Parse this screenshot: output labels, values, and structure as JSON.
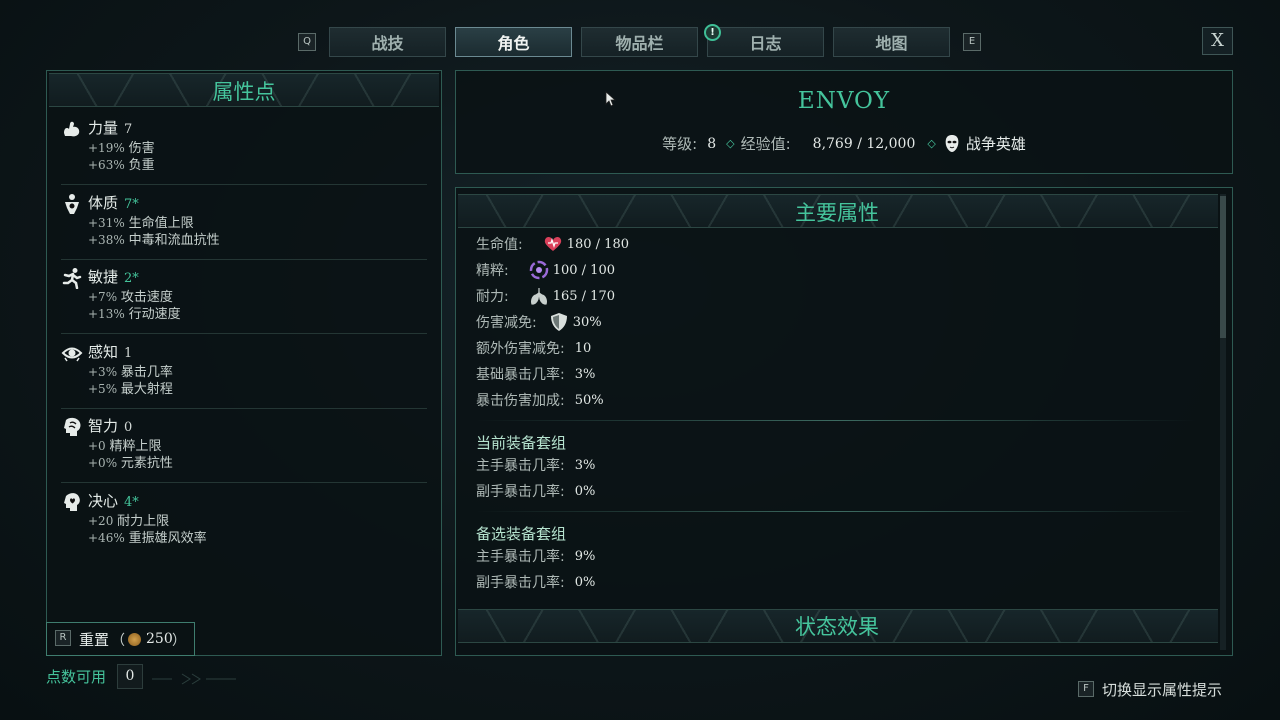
{
  "tabs": {
    "left_key": "Q",
    "right_key": "E",
    "items": [
      {
        "label": "战技"
      },
      {
        "label": "角色"
      },
      {
        "label": "物品栏"
      },
      {
        "label": "日志"
      },
      {
        "label": "地图"
      }
    ],
    "active_index": 1,
    "alert_symbol": "!",
    "close_label": "X"
  },
  "attributes": {
    "title": "属性点",
    "items": [
      {
        "name": "力量",
        "value": "7",
        "plus": false,
        "icon": "arm-icon",
        "lines": [
          {
            "num": "+19%",
            "text": "伤害"
          },
          {
            "num": "+63%",
            "text": "负重"
          }
        ]
      },
      {
        "name": "体质",
        "value": "7*",
        "plus": true,
        "icon": "body-icon",
        "lines": [
          {
            "num": "+31%",
            "text": "生命值上限"
          },
          {
            "num": "+38%",
            "text": "中毒和流血抗性"
          }
        ]
      },
      {
        "name": "敏捷",
        "value": "2*",
        "plus": true,
        "icon": "runner-icon",
        "lines": [
          {
            "num": "+7%",
            "text": "攻击速度"
          },
          {
            "num": "+13%",
            "text": "行动速度"
          }
        ]
      },
      {
        "name": "感知",
        "value": "1",
        "plus": false,
        "icon": "eye-icon",
        "lines": [
          {
            "num": "+3%",
            "text": "暴击几率"
          },
          {
            "num": "+5%",
            "text": "最大射程"
          }
        ]
      },
      {
        "name": "智力",
        "value": "0",
        "plus": false,
        "icon": "brain-icon",
        "lines": [
          {
            "num": "+0",
            "text": "精粹上限"
          },
          {
            "num": "+0%",
            "text": "元素抗性"
          }
        ]
      },
      {
        "name": "决心",
        "value": "4*",
        "plus": true,
        "icon": "heart-head-icon",
        "lines": [
          {
            "num": "+20",
            "text": "耐力上限"
          },
          {
            "num": "+46%",
            "text": "重振雄风效率"
          }
        ]
      }
    ],
    "reset": {
      "key": "R",
      "label": "重置",
      "open": "（",
      "cost": "250",
      "close": "）"
    },
    "points": {
      "label": "点数可用",
      "value": "0"
    }
  },
  "character": {
    "name": "ENVOY",
    "level_label": "等级:",
    "level": "8",
    "xp_label": "经验值:",
    "xp": "8,769 / 12,000",
    "title": "战争英雄"
  },
  "main_stats": {
    "title": "主要属性",
    "rows": [
      {
        "label": "生命值:",
        "icon": "heart-icon",
        "value": "180 / 180"
      },
      {
        "label": "精粹:",
        "icon": "essence-icon",
        "value": "100 / 100"
      },
      {
        "label": "耐力:",
        "icon": "lungs-icon",
        "value": "165 / 170"
      },
      {
        "label": "伤害减免:",
        "icon": "shield-icon",
        "value": "30%"
      },
      {
        "label": "额外伤害减免:",
        "icon": "",
        "value": "10"
      },
      {
        "label": "基础暴击几率:",
        "icon": "",
        "value": "3%"
      },
      {
        "label": "暴击伤害加成:",
        "icon": "",
        "value": "50%"
      }
    ],
    "current_set": {
      "title": "当前装备套组",
      "rows": [
        {
          "label": "主手暴击几率:",
          "value": "3%"
        },
        {
          "label": "副手暴击几率:",
          "value": "0%"
        }
      ]
    },
    "alt_set": {
      "title": "备选装备套组",
      "rows": [
        {
          "label": "主手暴击几率:",
          "value": "9%"
        },
        {
          "label": "副手暴击几率:",
          "value": "0%"
        }
      ]
    },
    "status_title": "状态效果"
  },
  "footer": {
    "key": "F",
    "label": "切换显示属性提示"
  },
  "colors": {
    "accent": "#45c49c",
    "panel_border": "#2e5a52"
  }
}
